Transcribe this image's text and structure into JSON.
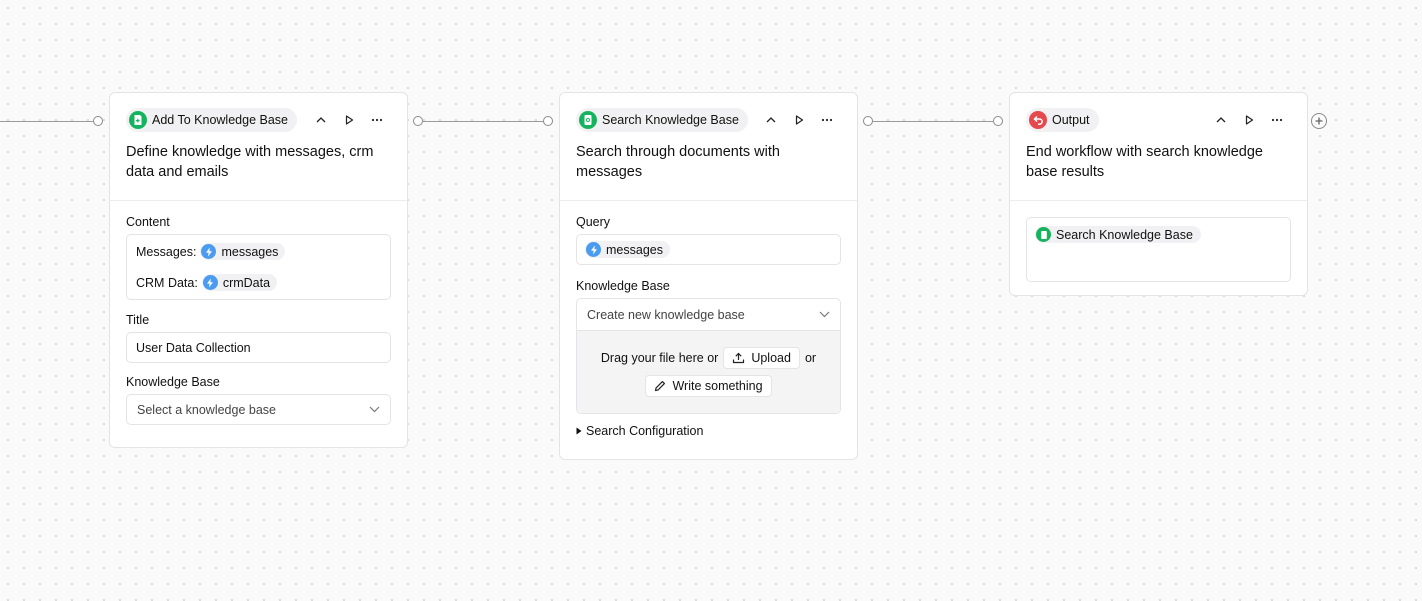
{
  "nodes": {
    "add": {
      "pill_label": "Add To Knowledge Base",
      "description": "Define knowledge with messages, crm data and emails",
      "content_label": "Content",
      "messages_key": "Messages:",
      "messages_var": "messages",
      "crm_key": "CRM Data:",
      "crm_var": "crmData",
      "title_label": "Title",
      "title_value": "User Data Collection",
      "kb_label": "Knowledge Base",
      "kb_placeholder": "Select a knowledge base"
    },
    "search": {
      "pill_label": "Search Knowledge Base",
      "description": "Search through documents with messages",
      "query_label": "Query",
      "query_var": "messages",
      "kb_label": "Knowledge Base",
      "kb_selected": "Create new knowledge base",
      "drag_text": "Drag your file here or",
      "upload_label": "Upload",
      "or_text": "or",
      "write_label": "Write something",
      "config_label": "Search Configuration"
    },
    "output": {
      "pill_label": "Output",
      "description": "End workflow with search knowledge base results",
      "ref_label": "Search Knowledge Base"
    }
  },
  "colors": {
    "accent_green": "#16b35e",
    "accent_red": "#e5484d",
    "variable_blue": "#4b9cf0"
  },
  "icons": {
    "add_node": "book-plus-icon",
    "search_node": "book-search-icon",
    "output_node": "undo-arrow-icon",
    "variable": "lightning-icon",
    "collapse": "chevron-up-icon",
    "run": "play-icon",
    "more": "ellipsis-icon",
    "dropdown": "chevron-down-icon",
    "upload": "upload-icon",
    "write": "pencil-icon",
    "expand_config": "triangle-right-icon",
    "add_step": "plus-circle-icon"
  }
}
